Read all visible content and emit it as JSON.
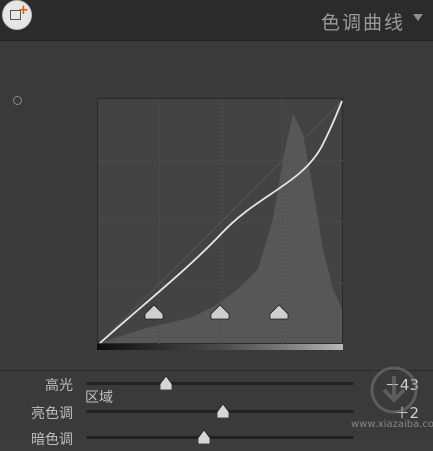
{
  "header": {
    "title": "色调曲线"
  },
  "panel": {
    "region_title": "区域",
    "sliders": [
      {
        "label": "高光",
        "value_text": "－43",
        "level": -43
      },
      {
        "label": "亮色调",
        "value_text": "＋2",
        "level": 2
      },
      {
        "label": "暗色调",
        "value_text": "",
        "level": -10
      }
    ],
    "split_points": [
      25,
      50,
      75
    ]
  },
  "watermark": {
    "text": "www.xiazaiba.com"
  }
}
